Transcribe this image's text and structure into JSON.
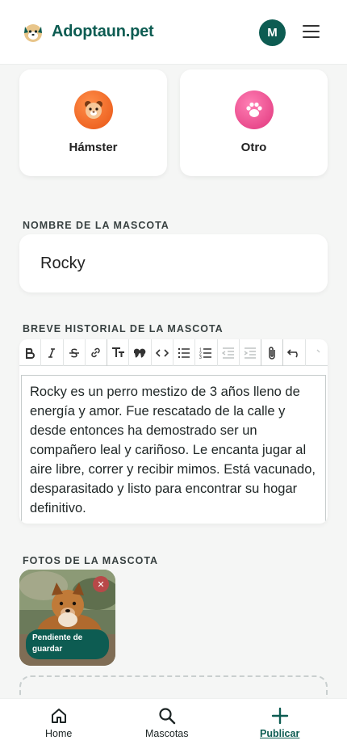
{
  "header": {
    "brand": "Adoptaun.pet",
    "avatar_initial": "M"
  },
  "species": [
    {
      "label": "Hámster",
      "icon": "hamster-icon",
      "color": "#f0641e"
    },
    {
      "label": "Otro",
      "icon": "paw-icon",
      "color": "#e83f86"
    }
  ],
  "form": {
    "name_label": "NOMBRE DE LA MASCOTA",
    "name_value": "Rocky",
    "history_label": "BREVE HISTORIAL DE LA MASCOTA",
    "history_text": "Rocky es un perro mestizo de 3 años lleno de energía y amor. Fue rescatado de la calle y desde entonces ha demostrado ser un compañero leal y cariñoso. Le encanta jugar al aire libre, correr y recibir mimos. Está vacunado, desparasitado y listo para encontrar su hogar definitivo.",
    "photos_label": "FOTOS DE LA MASCOTA"
  },
  "toolbar_buttons": [
    "bold",
    "italic",
    "strikethrough",
    "link",
    "heading",
    "quote",
    "code",
    "bullet-list",
    "numbered-list",
    "decrease-indent",
    "increase-indent",
    "attach",
    "undo"
  ],
  "photos": [
    {
      "status": "Pendiente de guardar"
    }
  ],
  "nav": {
    "home": "Home",
    "pets": "Mascotas",
    "publish": "Publicar"
  },
  "colors": {
    "brand": "#0d5c52",
    "remove": "#b84848"
  }
}
